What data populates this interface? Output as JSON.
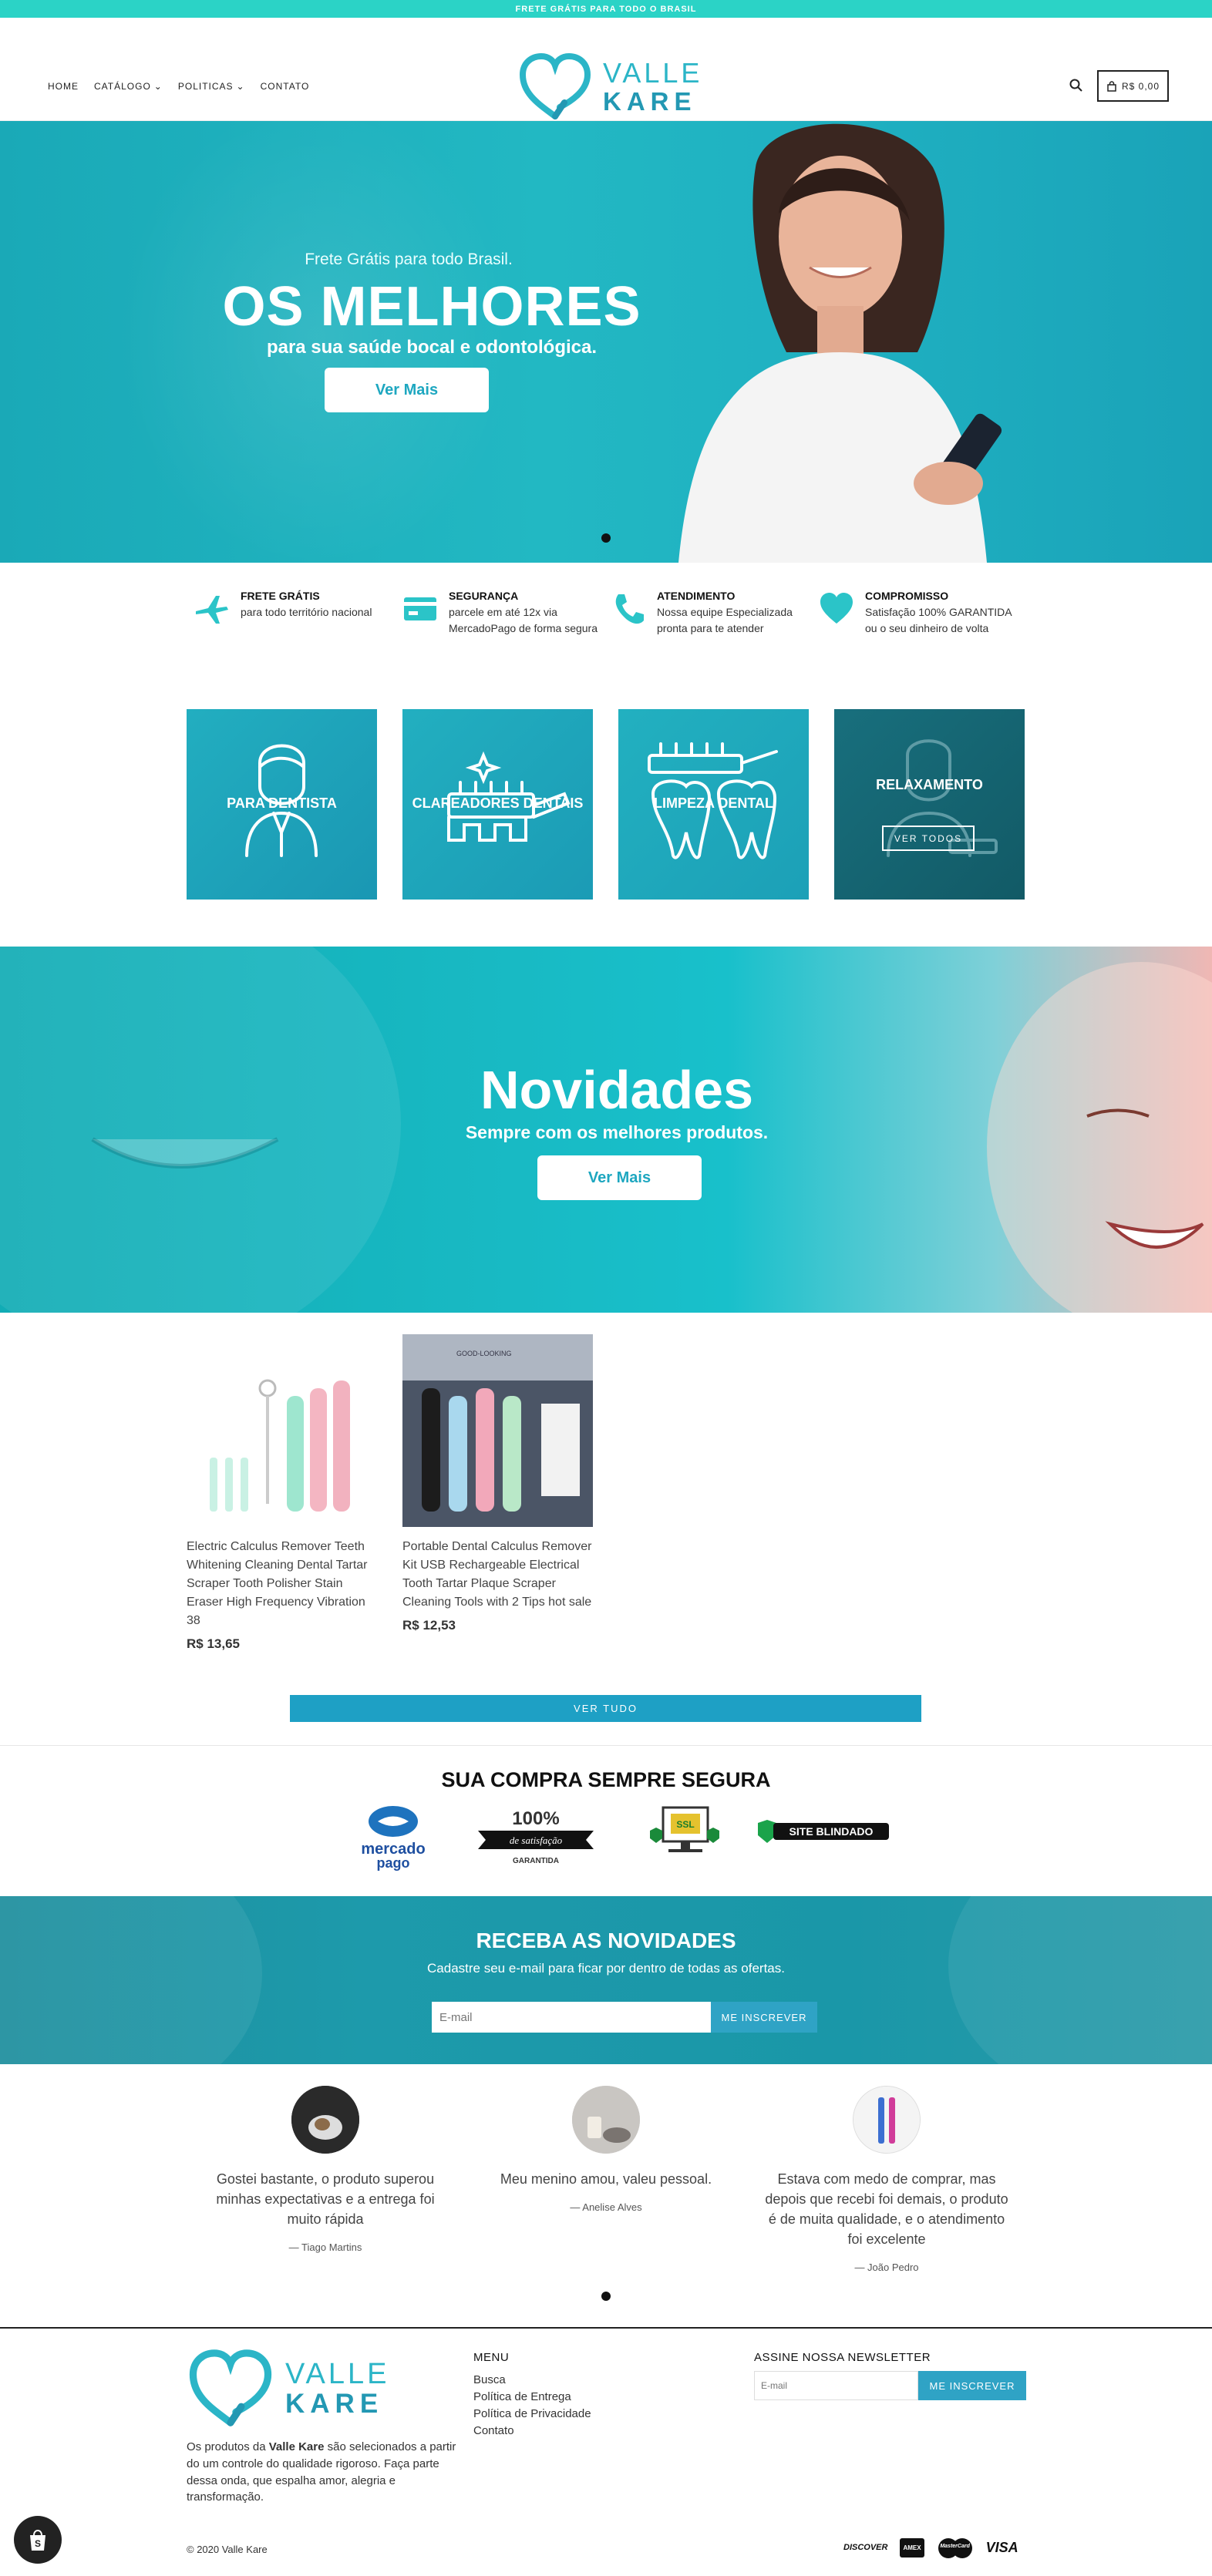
{
  "topbar": {
    "text": "FRETE GRÁTIS PARA TODO O BRASIL"
  },
  "header": {
    "nav": [
      {
        "label": "HOME",
        "dropdown": false
      },
      {
        "label": "CATÁLOGO",
        "dropdown": true
      },
      {
        "label": "POLITICAS",
        "dropdown": true
      },
      {
        "label": "CONTATO",
        "dropdown": false
      }
    ],
    "logo": {
      "line1": "VALLE",
      "line2": "KARE"
    },
    "cart_label": "R$ 0,00"
  },
  "hero": {
    "subtitle": "Frete Grátis para todo Brasil.",
    "title": "OS MELHORES",
    "description": "para sua saúde bocal e odontológica.",
    "button": "Ver Mais"
  },
  "features": [
    {
      "icon": "airplane-icon",
      "title": "FRETE GRÁTIS",
      "text": "para todo território nacional"
    },
    {
      "icon": "credit-card-icon",
      "title": "SEGURANÇA",
      "text": "parcele em até 12x via MercadoPago de forma segura"
    },
    {
      "icon": "phone-icon",
      "title": "ATENDIMENTO",
      "text": "Nossa equipe Especializada pronta para te atender"
    },
    {
      "icon": "heart-icon",
      "title": "COMPROMISSO",
      "text": "Satisfação 100% GARANTIDA ou o seu dinheiro de volta"
    }
  ],
  "categories": [
    {
      "label": "PARA DENTISTA",
      "icon": "dentist-icon",
      "color": "#1ea3b8"
    },
    {
      "label": "CLAREADORES DENTAIS",
      "icon": "toothbrush-sparkle-icon",
      "color": "#1da7bb"
    },
    {
      "label": "LIMPEZA DENTAL",
      "icon": "teeth-cleaning-icon",
      "color": "#1fa9bc"
    },
    {
      "label": "RELAXAMENTO",
      "icon": "relax-icon",
      "color": "#17606e",
      "button": "VER TODOS"
    }
  ],
  "banner2": {
    "title": "Novidades",
    "subtitle": "Sempre com os melhores produtos.",
    "button": "Ver Mais"
  },
  "products": [
    {
      "title": "Electric Calculus Remover Teeth Whitening Cleaning Dental Tartar Scraper Tooth Polisher Stain Eraser High Frequency Vibration 38",
      "price": "R$ 13,65"
    },
    {
      "title": "Portable Dental Calculus Remover Kit USB Rechargeable Electrical Tooth Tartar Plaque Scraper Cleaning Tools with 2 Tips hot sale",
      "price": "R$ 12,53",
      "image_caption": "GOOD-LOOKING"
    }
  ],
  "ver_tudo": "VER TUDO",
  "secure": {
    "title": "SUA COMPRA SEMPRE SEGURA",
    "badges": {
      "mp_line1": "mercado",
      "mp_line2": "pago",
      "pct": "100%",
      "satisfacao": "de satisfação",
      "garantida": "GARANTIDA",
      "ssl": "SSL",
      "blindado": "SITE BLINDADO"
    }
  },
  "newsletter": {
    "title": "RECEBA AS NOVIDADES",
    "subtitle": "Cadastre seu e-mail para ficar por dentro de todas as ofertas.",
    "placeholder": "E-mail",
    "button": "ME INSCREVER"
  },
  "testimonials": [
    {
      "quote": "Gostei bastante, o produto superou minhas expectativas e a entrega foi muito rápida",
      "author": "— Tiago Martins"
    },
    {
      "quote": "Meu menino amou, valeu pessoal.",
      "author": "— Anelise Alves"
    },
    {
      "quote": "Estava com medo de comprar, mas depois que recebi foi demais, o produto é de muita qualidade, e o atendimento foi excelente",
      "author": "— João Pedro"
    }
  ],
  "footer": {
    "about_pre": "Os produtos da ",
    "about_brand": "Valle Kare",
    "about_post": " são selecionados a partir do um controle do qualidade rigoroso. Faça parte dessa onda, que espalha amor, alegria e transformação.",
    "menu_title": "MENU",
    "menu": [
      "Busca",
      "Política de Entrega",
      "Política de Privacidade",
      "Contato"
    ],
    "newsletter_title": "ASSINE NOSSA NEWSLETTER",
    "newsletter_placeholder": "E-mail",
    "newsletter_button": "ME INSCREVER",
    "copyright": "© 2020 Valle Kare",
    "payments": [
      "DISCOVER",
      "AMEX",
      "MasterCard",
      "VISA"
    ]
  }
}
